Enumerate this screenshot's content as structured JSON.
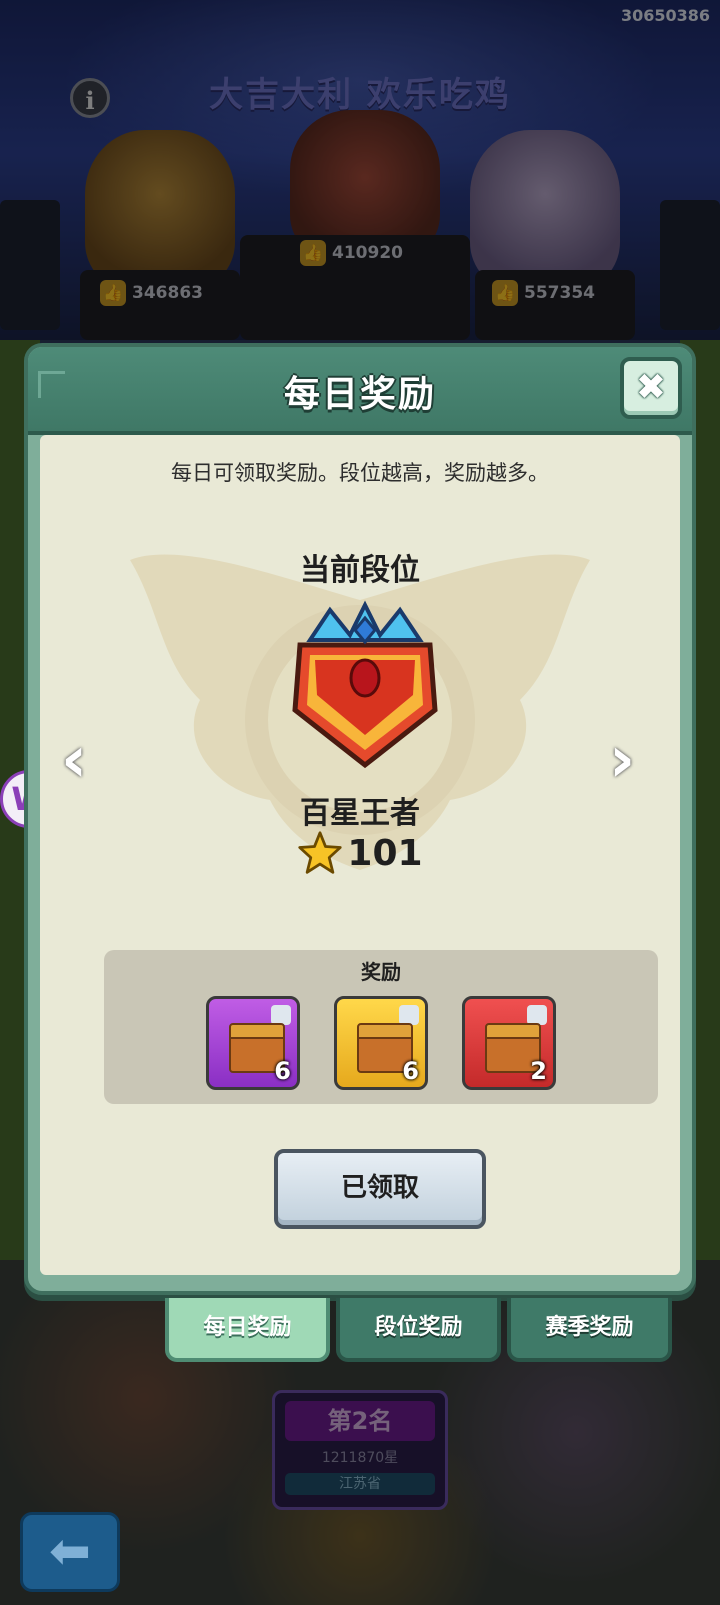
{
  "background": {
    "user_id": "30650386",
    "banner": "大吉大利 欢乐吃鸡",
    "info_icon": "i",
    "likes": [
      "346863",
      "410920",
      "557354"
    ],
    "thumb_icon": "👍",
    "leaderboard": {
      "rank": "第2名",
      "stars": "1211870星",
      "province": "江苏省"
    },
    "back_icon": "⬅",
    "side_badge": "W"
  },
  "modal": {
    "title": "每日奖励",
    "close_icon": "✖",
    "description": "每日可领取奖励。段位越高，奖励越多。",
    "current_rank_label": "当前段位",
    "rank_name": "百星王者",
    "star_count": "101",
    "arrow_left": "‹",
    "arrow_right": "›",
    "reward_label": "奖励",
    "rewards": [
      {
        "color": "#a745d8",
        "quantity": "6"
      },
      {
        "color": "#f2c234",
        "quantity": "6"
      },
      {
        "color": "#dc3b3b",
        "quantity": "2"
      }
    ],
    "claim_button": "已领取"
  },
  "tabs": [
    {
      "label": "每日奖励",
      "active": true
    },
    {
      "label": "段位奖励",
      "active": false
    },
    {
      "label": "赛季奖励",
      "active": false
    }
  ]
}
